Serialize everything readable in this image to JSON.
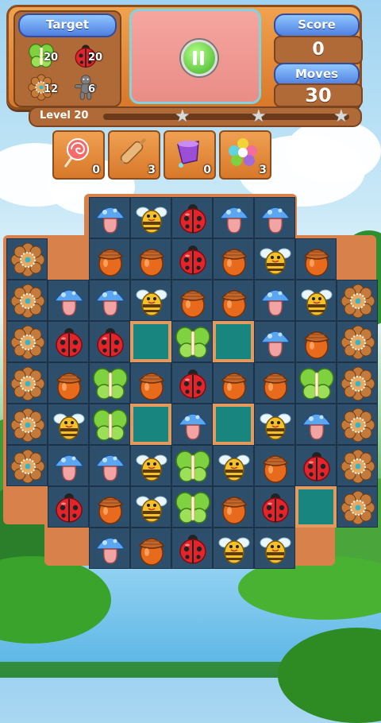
{
  "hud": {
    "target_label": "Target",
    "targets": [
      {
        "icon": "butterfly-icon",
        "count": "20"
      },
      {
        "icon": "ladybug-icon",
        "count": "20"
      },
      {
        "icon": "cookie-flower-icon",
        "count": "12"
      },
      {
        "icon": "gingerbread-man-icon",
        "count": "6"
      }
    ],
    "score_label": "Score",
    "score_value": "0",
    "moves_label": "Moves",
    "moves_value": "30"
  },
  "level": {
    "label": "Level 20",
    "progress": 0,
    "stars": 3
  },
  "boosters": [
    {
      "icon": "lollipop-icon",
      "count": "0"
    },
    {
      "icon": "rolling-pin-icon",
      "count": "3"
    },
    {
      "icon": "paint-bucket-icon",
      "count": "0"
    },
    {
      "icon": "color-bomb-icon",
      "count": "3"
    }
  ],
  "board": {
    "rows": [
      [
        "",
        "",
        "mushroom",
        "bee",
        "ladybug",
        "mushroom",
        "mushroom",
        "",
        ""
      ],
      [
        "cookie",
        "",
        "acorn",
        "acorn",
        "ladybug",
        "acorn",
        "bee",
        "acorn",
        ""
      ],
      [
        "cookie",
        "mushroom",
        "mushroom",
        "bee",
        "acorn",
        "acorn",
        "mushroom",
        "bee",
        "cookie"
      ],
      [
        "cookie",
        "ladybug",
        "ladybug",
        "hole",
        "butterfly",
        "hole",
        "mushroom",
        "acorn",
        "cookie"
      ],
      [
        "cookie",
        "acorn",
        "butterfly",
        "acorn",
        "ladybug",
        "acorn",
        "acorn",
        "butterfly",
        "cookie"
      ],
      [
        "cookie",
        "bee",
        "butterfly",
        "hole",
        "mushroom",
        "hole",
        "bee",
        "mushroom",
        "cookie"
      ],
      [
        "cookie",
        "mushroom",
        "mushroom",
        "bee",
        "butterfly",
        "bee",
        "acorn",
        "ladybug",
        "cookie"
      ],
      [
        "",
        "ladybug",
        "acorn",
        "bee",
        "butterfly",
        "acorn",
        "ladybug",
        "hole",
        "cookie"
      ],
      [
        "",
        "",
        "mushroom",
        "acorn",
        "ladybug",
        "bee",
        "bee",
        "",
        ""
      ]
    ]
  },
  "colors": {
    "hud_orange": "#d8782a",
    "pill_blue": "#4f7fe0",
    "cell_navy": "#2e4f6b",
    "hole_teal": "#18857f",
    "progress_green": "#6ee34c"
  }
}
